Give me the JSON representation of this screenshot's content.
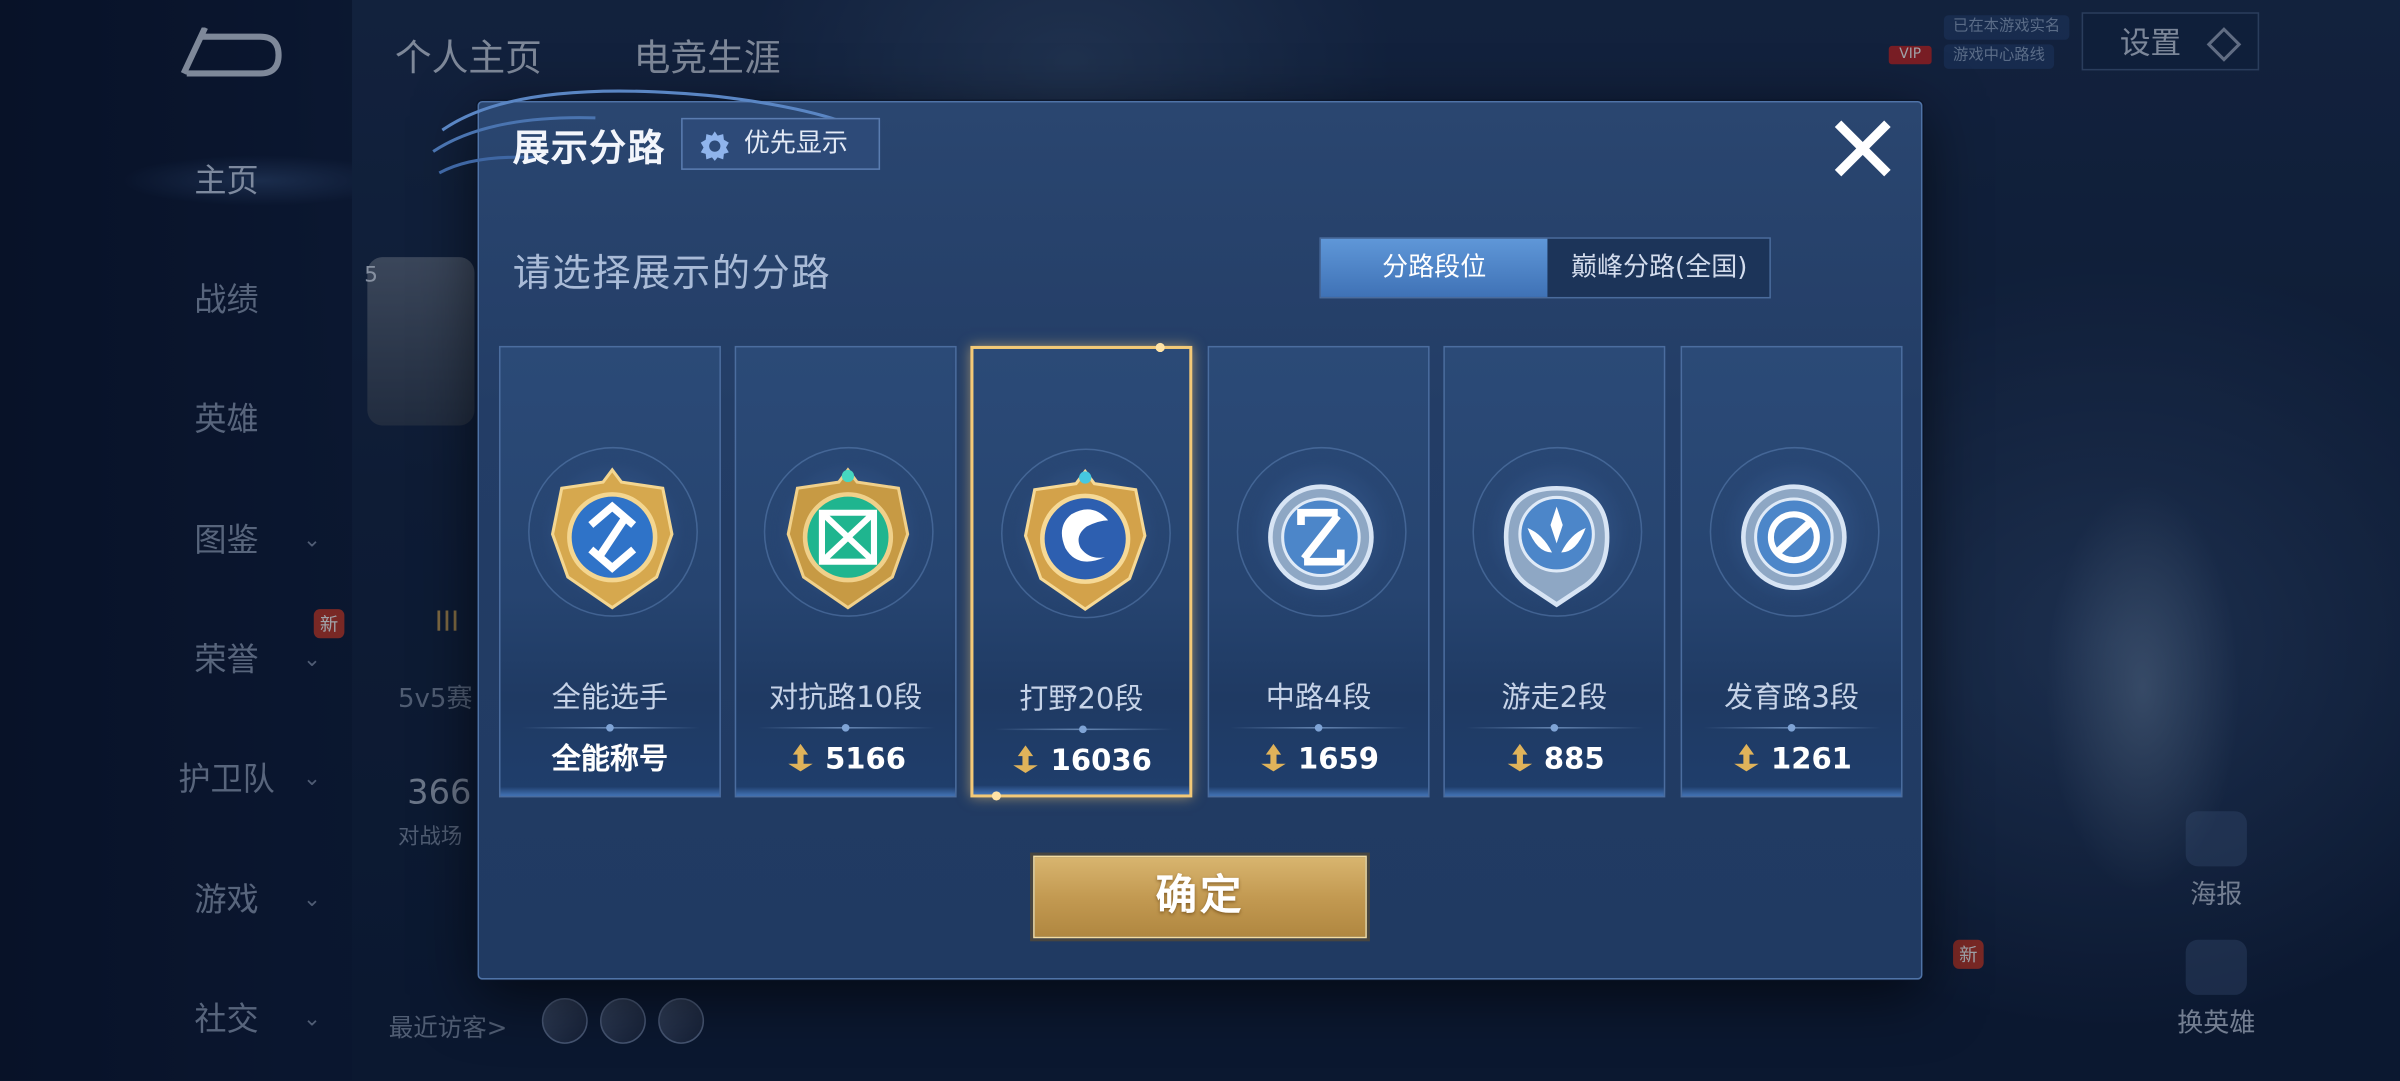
{
  "sidebar": {
    "items": [
      {
        "label": "主页",
        "has_chevron": false
      },
      {
        "label": "战绩",
        "has_chevron": false
      },
      {
        "label": "英雄",
        "has_chevron": false
      },
      {
        "label": "图鉴",
        "has_chevron": true
      },
      {
        "label": "荣誉",
        "has_chevron": true
      },
      {
        "label": "护卫队",
        "has_chevron": true
      },
      {
        "label": "游戏",
        "has_chevron": true
      },
      {
        "label": "社交",
        "has_chevron": true
      }
    ],
    "badge_new": "新"
  },
  "background": {
    "tabs": [
      "个人主页",
      "电竞生涯"
    ],
    "settings_label": "设置",
    "vip_label": "VIP",
    "promo_tags": [
      "已在本游戏实名",
      "游戏中心路线"
    ],
    "recent_visitors_label": "最近访客>",
    "count_text": "366",
    "battle_text": "对战场",
    "mode_text": "5v5赛",
    "tier_text": "III",
    "level_text": "5",
    "poster_label": "海报",
    "swap_hero_label": "换英雄",
    "badge_new": "新"
  },
  "modal": {
    "title": "展示分路",
    "priority_label": "优先显示",
    "subtitle": "请选择展示的分路",
    "tabs": [
      {
        "label": "分路段位",
        "active": true
      },
      {
        "label": "巅峰分路(全国)",
        "active": false
      }
    ],
    "cards": [
      {
        "rank": "全能选手",
        "score": "全能称号",
        "emblem": "all-round-emblem-icon",
        "selected": false
      },
      {
        "rank": "对抗路10段",
        "score": "5166",
        "emblem": "clash-lane-emblem-icon",
        "selected": false
      },
      {
        "rank": "打野20段",
        "score": "16036",
        "emblem": "jungle-emblem-icon",
        "selected": true
      },
      {
        "rank": "中路4段",
        "score": "1659",
        "emblem": "mid-lane-emblem-icon",
        "selected": false
      },
      {
        "rank": "游走2段",
        "score": "885",
        "emblem": "roam-emblem-icon",
        "selected": false
      },
      {
        "rank": "发育路3段",
        "score": "1261",
        "emblem": "farm-lane-emblem-icon",
        "selected": false
      }
    ],
    "confirm_label": "确定"
  },
  "colors": {
    "accent_gold": "#f3c977",
    "tab_active": "#4f86c9",
    "panel": "#243f68"
  }
}
